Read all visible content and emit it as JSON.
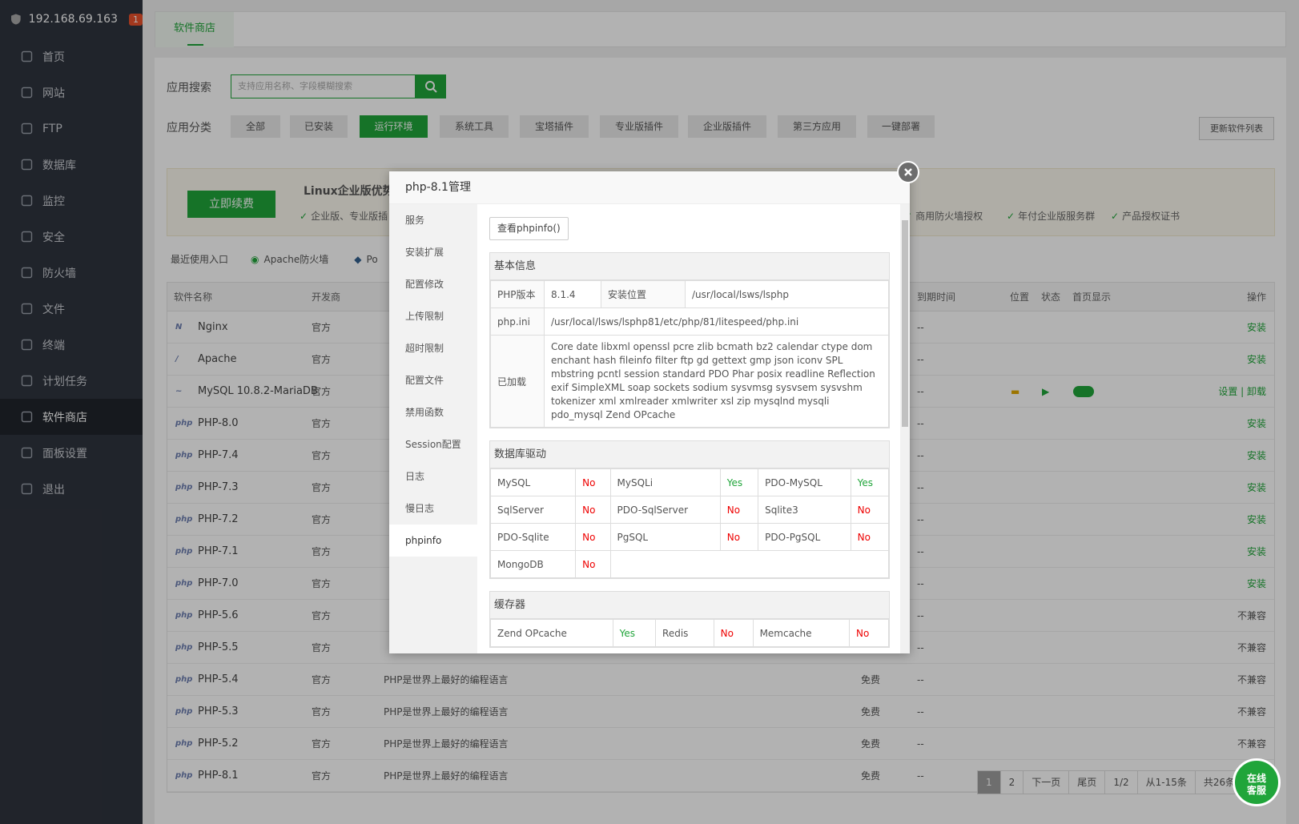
{
  "sidebar": {
    "host": "192.168.69.163",
    "badge": "1",
    "items": [
      {
        "label": "首页",
        "icon": "home-icon"
      },
      {
        "label": "网站",
        "icon": "globe-icon"
      },
      {
        "label": "FTP",
        "icon": "ftp-icon"
      },
      {
        "label": "数据库",
        "icon": "database-icon"
      },
      {
        "label": "监控",
        "icon": "monitor-icon"
      },
      {
        "label": "安全",
        "icon": "shield-icon"
      },
      {
        "label": "防火墙",
        "icon": "firewall-icon"
      },
      {
        "label": "文件",
        "icon": "folder-icon"
      },
      {
        "label": "终端",
        "icon": "terminal-icon"
      },
      {
        "label": "计划任务",
        "icon": "calendar-icon"
      },
      {
        "label": "软件商店",
        "icon": "apps-icon"
      },
      {
        "label": "面板设置",
        "icon": "gear-icon"
      },
      {
        "label": "退出",
        "icon": "logout-icon"
      }
    ]
  },
  "tab": "软件商店",
  "search": {
    "label": "应用搜索",
    "placeholder": "支持应用名称、字段模糊搜索"
  },
  "category": {
    "label": "应用分类",
    "items": [
      "全部",
      "已安装",
      "运行环境",
      "系统工具",
      "宝塔插件",
      "专业版插件",
      "企业版插件",
      "第三方应用",
      "一键部署"
    ],
    "refresh": "更新软件列表"
  },
  "banner": {
    "button": "立即续费",
    "title": "Linux企业版优势",
    "features": [
      "企业版、专业版插",
      "商用防火墙授权",
      "年付企业版服务群",
      "产品授权证书"
    ]
  },
  "recent": {
    "label": "最近使用入口",
    "items": [
      "Apache防火墙",
      "Po"
    ]
  },
  "table": {
    "headers": [
      "软件名称",
      "开发商",
      "到期时间",
      "位置",
      "状态",
      "首页显示",
      "操作"
    ],
    "rows": [
      {
        "icon": "N",
        "name": "Nginx",
        "dev": "官方",
        "desc": "",
        "price": "",
        "expire": "--",
        "op": "安装"
      },
      {
        "icon": "/",
        "name": "Apache",
        "dev": "官方",
        "desc": "",
        "price": "",
        "expire": "--",
        "op": "安装"
      },
      {
        "icon": "~",
        "name": "MySQL 10.8.2-MariaDB",
        "dev": "官方",
        "desc": "",
        "price": "",
        "expire": "--",
        "op": "设置 | 卸载"
      },
      {
        "icon": "php",
        "name": "PHP-8.0",
        "dev": "官方",
        "desc": "",
        "price": "",
        "expire": "--",
        "op": "安装"
      },
      {
        "icon": "php",
        "name": "PHP-7.4",
        "dev": "官方",
        "desc": "",
        "price": "",
        "expire": "--",
        "op": "安装"
      },
      {
        "icon": "php",
        "name": "PHP-7.3",
        "dev": "官方",
        "desc": "",
        "price": "",
        "expire": "--",
        "op": "安装"
      },
      {
        "icon": "php",
        "name": "PHP-7.2",
        "dev": "官方",
        "desc": "",
        "price": "",
        "expire": "--",
        "op": "安装"
      },
      {
        "icon": "php",
        "name": "PHP-7.1",
        "dev": "官方",
        "desc": "",
        "price": "",
        "expire": "--",
        "op": "安装"
      },
      {
        "icon": "php",
        "name": "PHP-7.0",
        "dev": "官方",
        "desc": "",
        "price": "",
        "expire": "--",
        "op": "安装"
      },
      {
        "icon": "php",
        "name": "PHP-5.6",
        "dev": "官方",
        "desc": "",
        "price": "",
        "expire": "--",
        "op": "不兼容"
      },
      {
        "icon": "php",
        "name": "PHP-5.5",
        "dev": "官方",
        "desc": "",
        "price": "",
        "expire": "--",
        "op": "不兼容"
      },
      {
        "icon": "php",
        "name": "PHP-5.4",
        "dev": "官方",
        "desc": "PHP是世界上最好的编程语言",
        "price": "免费",
        "expire": "--",
        "op": "不兼容"
      },
      {
        "icon": "php",
        "name": "PHP-5.3",
        "dev": "官方",
        "desc": "PHP是世界上最好的编程语言",
        "price": "免费",
        "expire": "--",
        "op": "不兼容"
      },
      {
        "icon": "php",
        "name": "PHP-5.2",
        "dev": "官方",
        "desc": "PHP是世界上最好的编程语言",
        "price": "免费",
        "expire": "--",
        "op": "不兼容"
      },
      {
        "icon": "php",
        "name": "PHP-8.1",
        "dev": "官方",
        "desc": "PHP是世界上最好的编程语言",
        "price": "免费",
        "expire": "--",
        "op": ""
      }
    ]
  },
  "pager": [
    "1",
    "2",
    "下一页",
    "尾页",
    "1/2",
    "从1-15条",
    "共26条"
  ],
  "float": {
    "line1": "在线",
    "line2": "客服"
  },
  "modal": {
    "title": "php-8.1管理",
    "menu": [
      "服务",
      "安装扩展",
      "配置修改",
      "上传限制",
      "超时限制",
      "配置文件",
      "禁用函数",
      "Session配置",
      "日志",
      "慢日志",
      "phpinfo"
    ],
    "view_btn": "查看phpinfo()",
    "basic": {
      "title": "基本信息",
      "ver_label": "PHP版本",
      "ver": "8.1.4",
      "loc_label": "安装位置",
      "loc": "/usr/local/lsws/lsphp",
      "ini_label": "php.ini",
      "ini": "/usr/local/lsws/lsphp81/etc/php/81/litespeed/php.ini",
      "loaded_label": "已加载",
      "loaded": "Core date libxml openssl pcre zlib bcmath bz2 calendar ctype dom enchant hash fileinfo filter ftp gd gettext gmp json iconv SPL mbstring pcntl session standard PDO Phar posix readline Reflection exif SimpleXML soap sockets sodium sysvmsg sysvsem sysvshm tokenizer xml xmlreader xmlwriter xsl zip mysqlnd mysqli pdo_mysql Zend OPcache"
    },
    "db": {
      "title": "数据库驱动",
      "rows": [
        [
          "MySQL",
          "No",
          "MySQLi",
          "Yes",
          "PDO-MySQL",
          "Yes"
        ],
        [
          "SqlServer",
          "No",
          "PDO-SqlServer",
          "No",
          "Sqlite3",
          "No"
        ],
        [
          "PDO-Sqlite",
          "No",
          "PgSQL",
          "No",
          "PDO-PgSQL",
          "No"
        ],
        [
          "MongoDB",
          "No",
          "",
          "",
          "",
          ""
        ]
      ]
    },
    "cache": {
      "title": "缓存器",
      "row": [
        "Zend OPcache",
        "Yes",
        "Redis",
        "No",
        "Memcache",
        "No"
      ]
    }
  }
}
